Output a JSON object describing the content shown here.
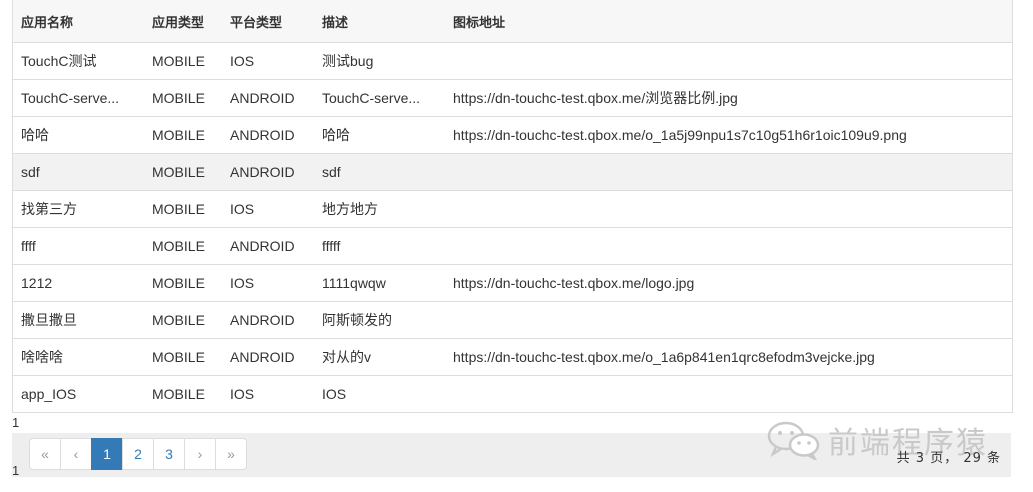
{
  "table": {
    "headers": [
      "应用名称",
      "应用类型",
      "平台类型",
      "描述",
      "图标地址"
    ],
    "rows": [
      [
        "TouchC测试",
        "MOBILE",
        "IOS",
        "测试bug",
        ""
      ],
      [
        "TouchC-serve...",
        "MOBILE",
        "ANDROID",
        "TouchC-serve...",
        "https://dn-touchc-test.qbox.me/浏览器比例.jpg"
      ],
      [
        "哈哈",
        "MOBILE",
        "ANDROID",
        "哈哈",
        "https://dn-touchc-test.qbox.me/o_1a5j99npu1s7c10g51h6r1oic109u9.png"
      ],
      [
        "sdf",
        "MOBILE",
        "ANDROID",
        "sdf",
        ""
      ],
      [
        "找第三方",
        "MOBILE",
        "IOS",
        "地方地方",
        ""
      ],
      [
        "ffff",
        "MOBILE",
        "ANDROID",
        "fffff",
        ""
      ],
      [
        "1212",
        "MOBILE",
        "IOS",
        "1111qwqw",
        "https://dn-touchc-test.qbox.me/logo.jpg"
      ],
      [
        "撒旦撒旦",
        "MOBILE",
        "ANDROID",
        "阿斯顿发的",
        ""
      ],
      [
        "啥啥啥",
        "MOBILE",
        "ANDROID",
        "对从的v",
        "https://dn-touchc-test.qbox.me/o_1a6p841en1qrc8efodm3vejcke.jpg"
      ],
      [
        "app_IOS",
        "MOBILE",
        "IOS",
        "IOS",
        ""
      ]
    ]
  },
  "page_number_top": "1",
  "page_number_bottom": "1",
  "pagination": {
    "first": "«",
    "prev": "‹",
    "pages": [
      "1",
      "2",
      "3"
    ],
    "active_page": "1",
    "next": "›",
    "last": "»"
  },
  "summary": "共 3 页， 29 条",
  "watermark": {
    "text": "前端程序猿",
    "icon": "wechat-icon"
  },
  "colors": {
    "accent": "#337ab7",
    "row_alt": "#f2f2f2",
    "pager_bg": "#eeeeee"
  }
}
